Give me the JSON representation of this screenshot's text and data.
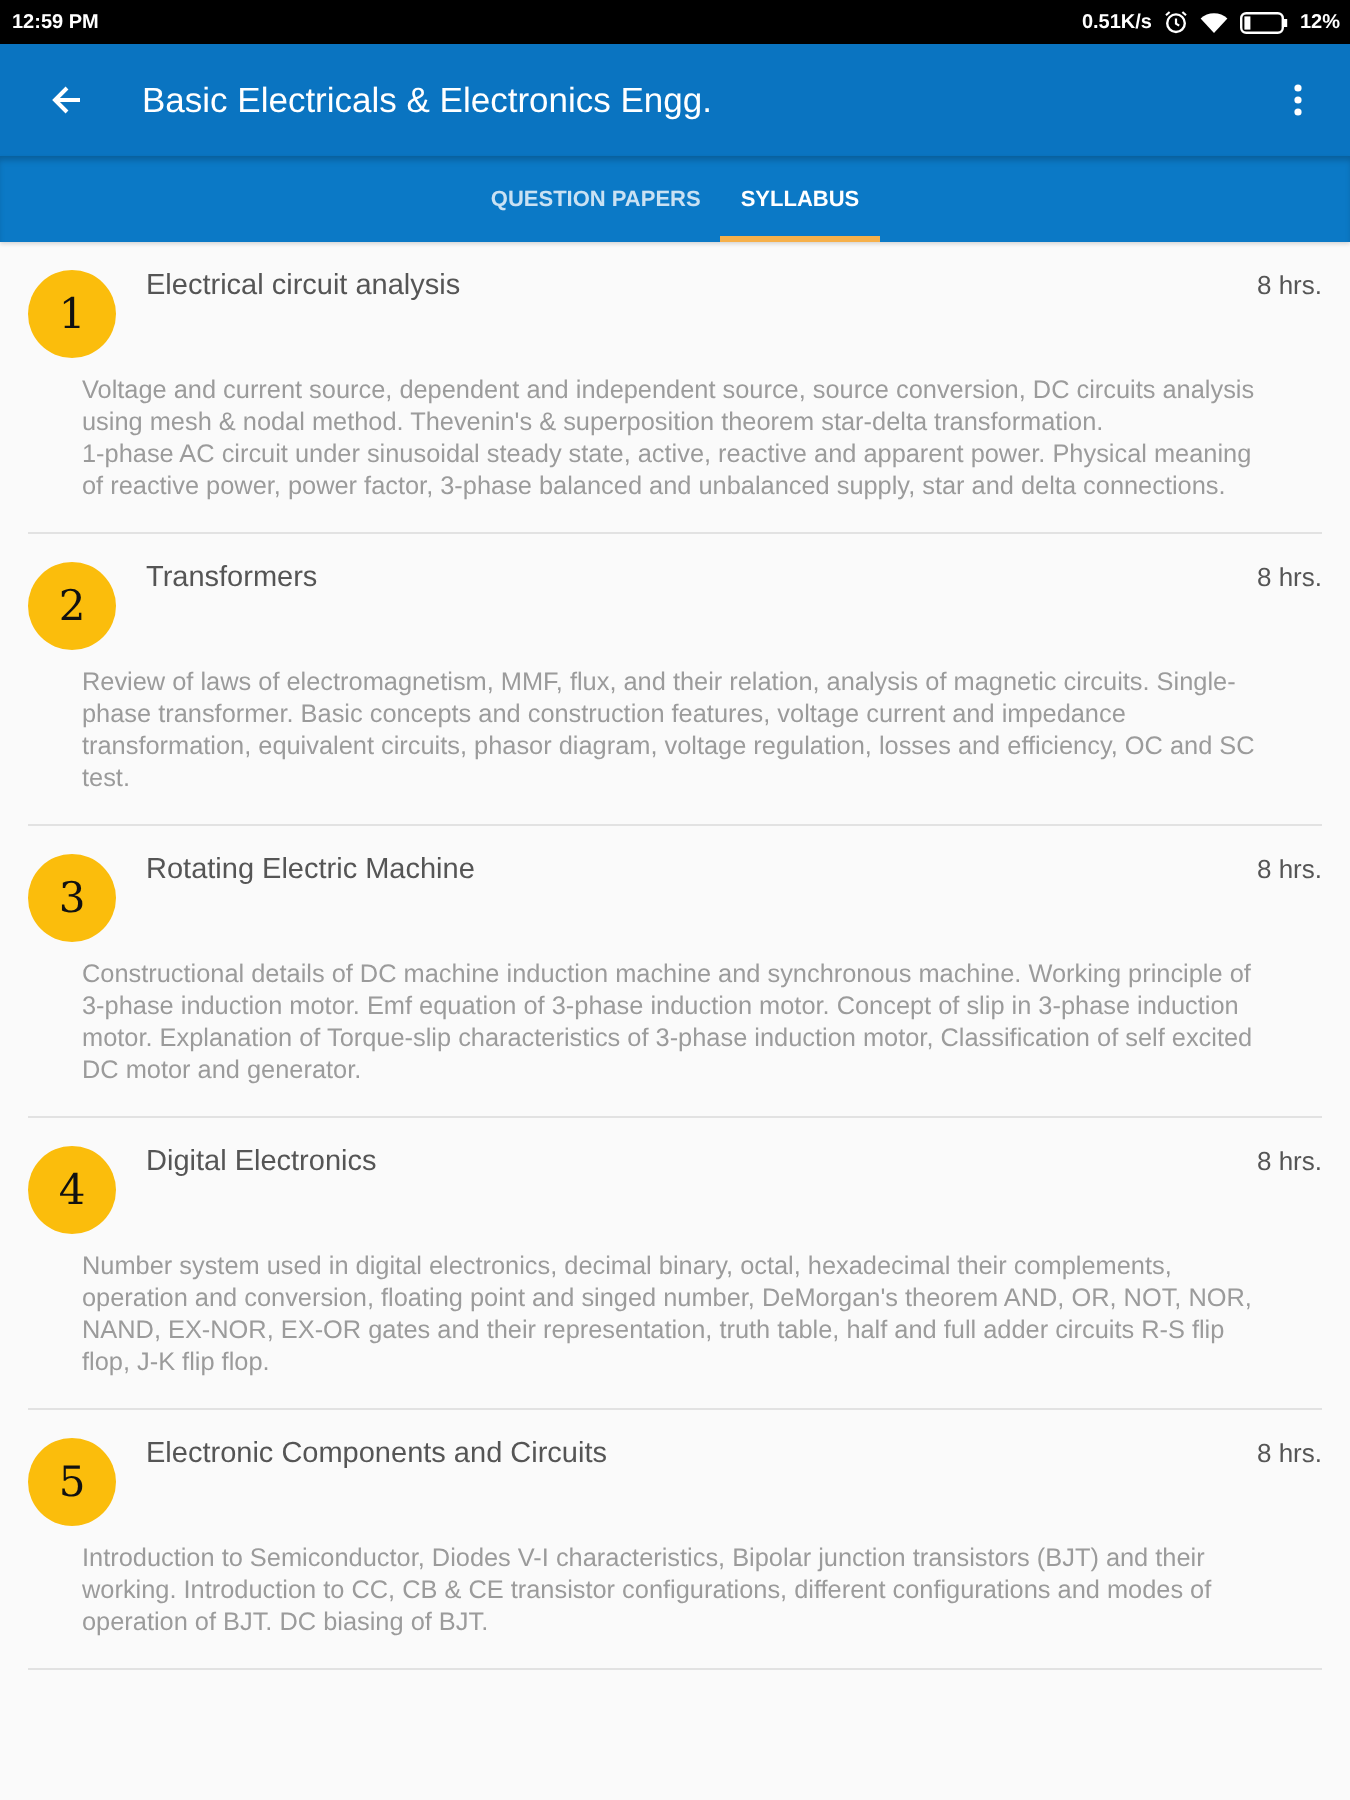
{
  "status_bar": {
    "time": "12:59 PM",
    "network_speed": "0.51K/s",
    "battery_percent": "12%"
  },
  "app_bar": {
    "title": "Basic Electricals & Electronics Engg."
  },
  "tabs": [
    {
      "label": "QUESTION PAPERS",
      "selected": false
    },
    {
      "label": "SYLLABUS",
      "selected": true
    }
  ],
  "units": [
    {
      "number": "1",
      "title": "Electrical circuit analysis",
      "duration": "8 hrs.",
      "description": "Voltage and current source, dependent and independent source, source conversion, DC circuits analysis using mesh & nodal method. Thevenin's & superposition theorem star-delta transformation.\n1-phase AC circuit under sinusoidal steady state, active, reactive and apparent power. Physical meaning of reactive power, power factor, 3-phase balanced and unbalanced supply, star and delta connections."
    },
    {
      "number": "2",
      "title": "Transformers",
      "duration": "8 hrs.",
      "description": "Review of laws of electromagnetism, MMF, flux, and their relation, analysis of magnetic circuits. Single-phase transformer. Basic concepts and construction features, voltage current and impedance transformation, equivalent circuits, phasor diagram, voltage regulation, losses and efficiency, OC and SC test."
    },
    {
      "number": "3",
      "title": "Rotating Electric Machine",
      "duration": "8 hrs.",
      "description": "Constructional details of DC machine induction machine and synchronous machine. Working principle of 3-phase induction motor. Emf equation of 3-phase induction motor. Concept of slip in 3-phase induction motor. Explanation of Torque-slip characteristics of 3-phase induction motor, Classification of self excited DC motor and generator."
    },
    {
      "number": "4",
      "title": "Digital Electronics",
      "duration": "8 hrs.",
      "description": "Number system used in digital electronics, decimal binary, octal, hexadecimal their complements, operation and conversion, floating point and singed number, DeMorgan's theorem AND, OR, NOT, NOR, NAND, EX-NOR, EX-OR gates and their representation, truth table, half and full adder circuits R-S flip flop, J-K flip flop."
    },
    {
      "number": "5",
      "title": "Electronic Components and Circuits",
      "duration": "8 hrs.",
      "description": "Introduction to Semiconductor, Diodes V-I characteristics, Bipolar junction transistors (BJT) and their working. Introduction to CC, CB & CE transistor configurations, different configurations and modes of operation of BJT. DC biasing of BJT."
    }
  ]
}
